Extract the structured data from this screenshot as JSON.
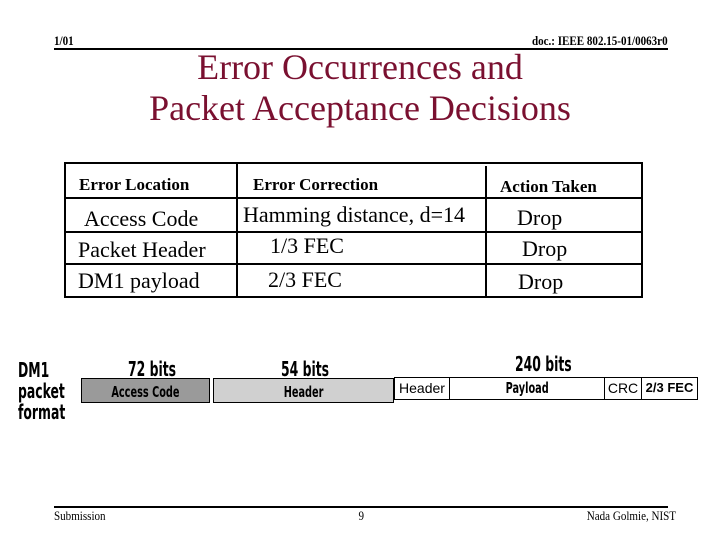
{
  "header": {
    "date": "1/01",
    "doc_id": "doc.: IEEE 802.15-01/0063r0"
  },
  "title": {
    "line1": "Error Occurrences and",
    "line2": "Packet Acceptance Decisions"
  },
  "table": {
    "columns": [
      "Error Location",
      "Error Correction",
      "Action Taken"
    ],
    "rows": [
      [
        "Access Code",
        "Hamming distance, d=14",
        "Drop"
      ],
      [
        "Packet Header",
        "1/3 FEC",
        "Drop"
      ],
      [
        "DM1 payload",
        "2/3 FEC",
        "Drop"
      ]
    ]
  },
  "diagram": {
    "label_lines": [
      "DM1",
      "packet",
      "format"
    ],
    "segments": [
      {
        "label": "Access Code",
        "bits": "72 bits",
        "color": "#9a9a9a"
      },
      {
        "label": "Header",
        "bits": "54 bits",
        "color": "#d0d0d0"
      }
    ],
    "payload_group": {
      "bits": "240 bits",
      "fields": [
        "Header",
        "Payload",
        "CRC",
        "2/3 FEC"
      ]
    }
  },
  "footer": {
    "left": "Submission",
    "center": "9",
    "right": "Nada Golmie, NIST"
  },
  "colors": {
    "title": "#7a1030"
  }
}
